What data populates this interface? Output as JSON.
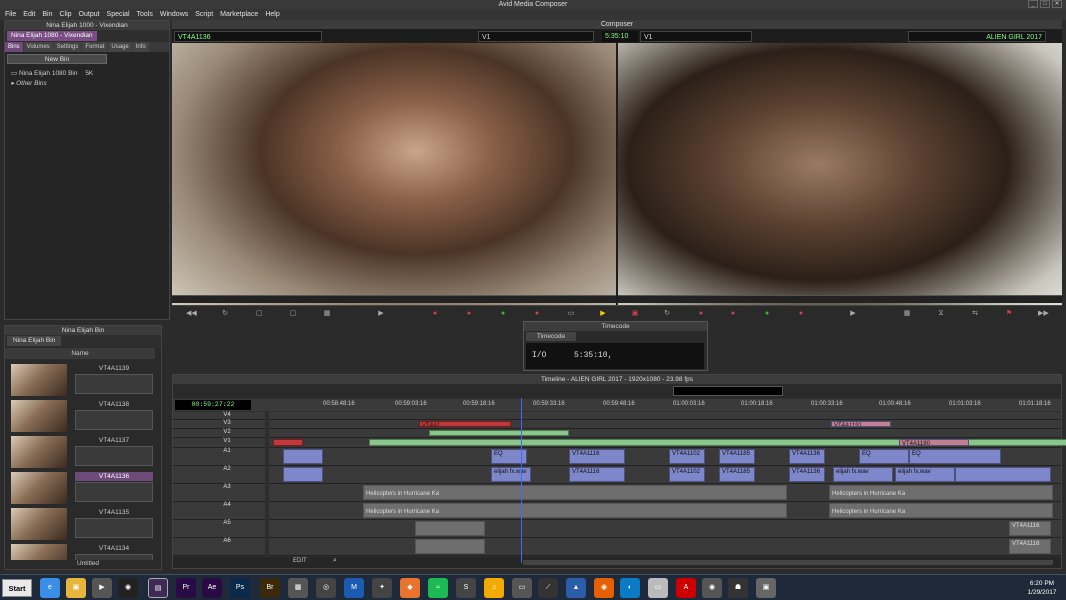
{
  "app": {
    "title": "Avid Media Composer"
  },
  "menu": [
    "File",
    "Edit",
    "Bin",
    "Clip",
    "Output",
    "Special",
    "Tools",
    "Windows",
    "Script",
    "Marketplace",
    "Help"
  ],
  "project": {
    "title": "Nina Elijah 1000 - Vixendian",
    "tab": "Nina Elijah 1080 - Vixendian",
    "subtabs": [
      "Bins",
      "Volumes",
      "Settings",
      "Format",
      "Usage",
      "Info"
    ],
    "new_bin": "New Bin",
    "bins": [
      {
        "name": "Nina Elijah 1080 Bin",
        "size": "5K"
      },
      {
        "name": "Other Bins",
        "size": ""
      }
    ]
  },
  "nina_bin": {
    "title": "Nina Elijah Bin",
    "tab": "Nina Elijah Bin",
    "header": "Name",
    "clips": [
      "",
      "VT4A1139",
      "VT4A1138",
      "VT4A1137",
      "VT4A1136",
      "VT4A1135",
      "VT4A1134"
    ],
    "selected": "VT4A1136",
    "footer": "Untitled"
  },
  "composer": {
    "title": "Composer",
    "source_clip": "VT4A1136",
    "track_a": "V1",
    "timecode": "5:35:10",
    "track_b": "V1",
    "sequence": "ALIEN GIRL 2017"
  },
  "timecode_tool": {
    "title": "Timecode",
    "tab": "Timecode",
    "label": "I/O",
    "value": "5:35:10,"
  },
  "timeline": {
    "title": "Timeline - ALIEN GIRL 2017 - 1920x1080 - 23.98 fps",
    "position": "00:59:27:22",
    "ruler": [
      "00:58:48:16",
      "00:59:03:16",
      "00:59:18:16",
      "00:59:33:16",
      "00:59:48:16",
      "01:00:03:16",
      "01:00:18:16",
      "01:00:33:16",
      "01:00:48:16",
      "01:01:03:16",
      "01:01:18:16"
    ],
    "tracks": [
      "V4",
      "V3",
      "V2",
      "V1",
      "A1",
      "A2",
      "A3",
      "A4",
      "A5",
      "A6"
    ],
    "edit_mode": "EDIT",
    "clip_labels": {
      "v3_a": "VT4A1",
      "v3_b": "VT4A1191",
      "v1_a": "VT4A1190",
      "a1_names": [
        "VT4A1116",
        "VT4A1102",
        "VT4A1185",
        "VT4A1136"
      ],
      "a3": "Helicopters in Hurricane Ka",
      "a4": "Helicopters in Hurricane Ka",
      "a5": "VT4A1116",
      "a6": "VT4A1116",
      "elijah": "elijah fx.wav",
      "eq": "EQ"
    }
  },
  "taskbar": {
    "start": "Start",
    "time": "6:20 PM",
    "date": "1/29/2017"
  }
}
